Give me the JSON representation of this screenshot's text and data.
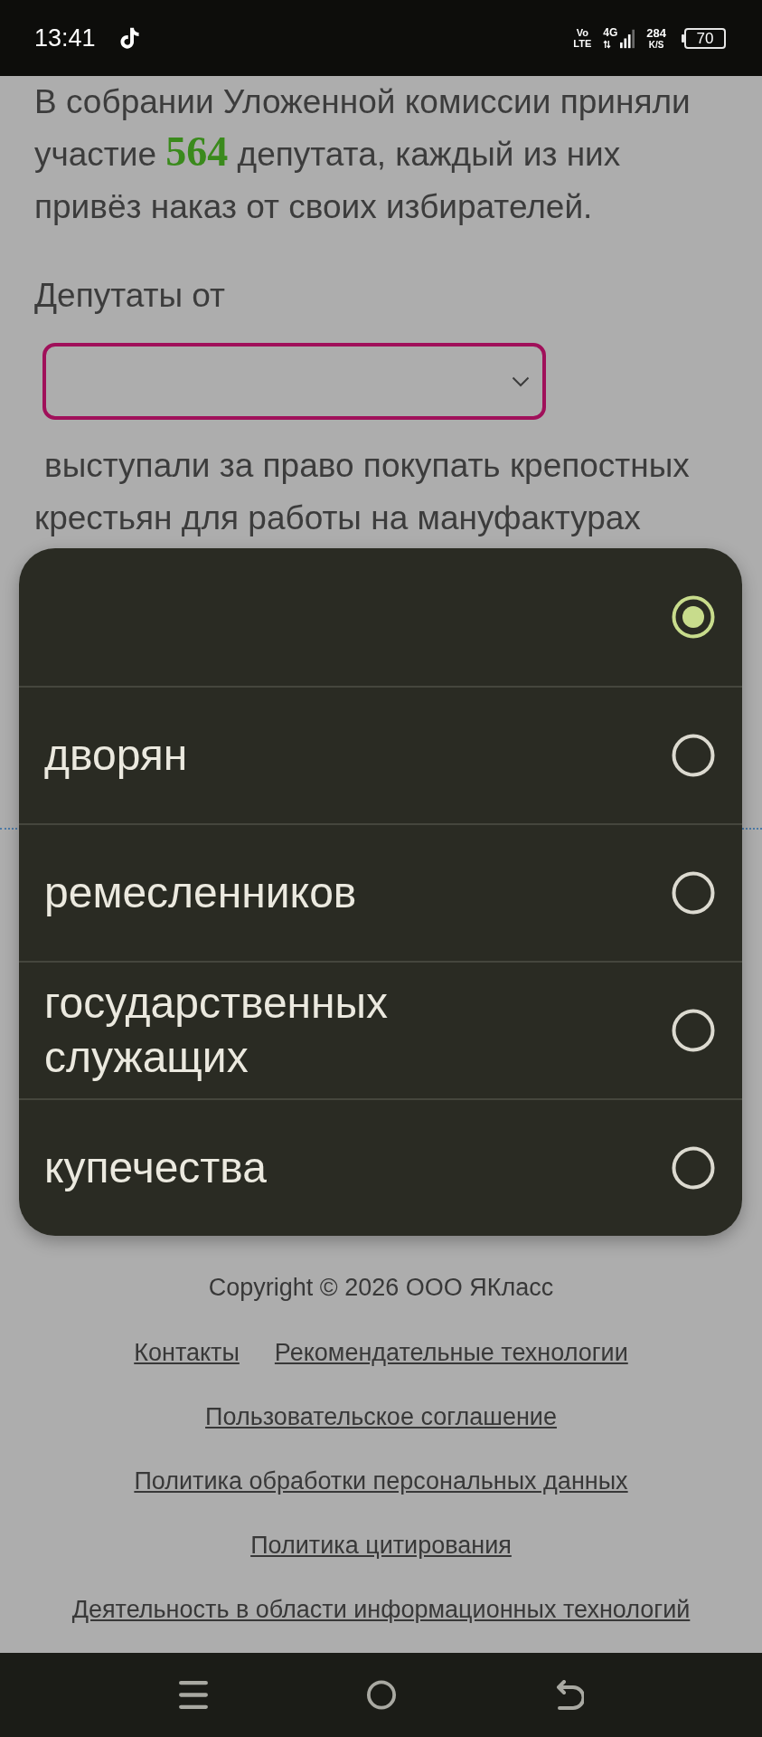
{
  "status_bar": {
    "time": "13:41",
    "volte": "Vo LTE",
    "network": "4G",
    "speed": "284",
    "speed_unit": "K/S",
    "battery": "70"
  },
  "question": {
    "paragraph": "В собрании Уложенной комиссии приняли участие **564** депутата, каждый из них привёз наказ от своих избирателей.",
    "prompt": "Депутаты от",
    "select": {
      "expanded": true,
      "options": [
        {
          "selected": true
        },
        {
          "label": "дворян",
          "selected": false
        },
        {
          "label": "ремесленников",
          "selected": false
        },
        {
          "label": "государственных служащих",
          "selected": false
        },
        {
          "label": "купечества",
          "selected": false
        }
      ]
    },
    "continuation": "выступали за право покупать крепостных крестьян для работы на мануфактурах"
  },
  "footer": {
    "copyright": "Copyright © 2026 ООО ЯКласс",
    "link_rows": [
      [
        "Контакты",
        "Рекомендательные технологии"
      ],
      [
        "Пользовательское соглашение"
      ],
      [
        "Политика обработки персональных данных"
      ],
      [
        "Политика цитирования"
      ],
      [
        "Деятельность в области информационных технологий"
      ]
    ]
  }
}
